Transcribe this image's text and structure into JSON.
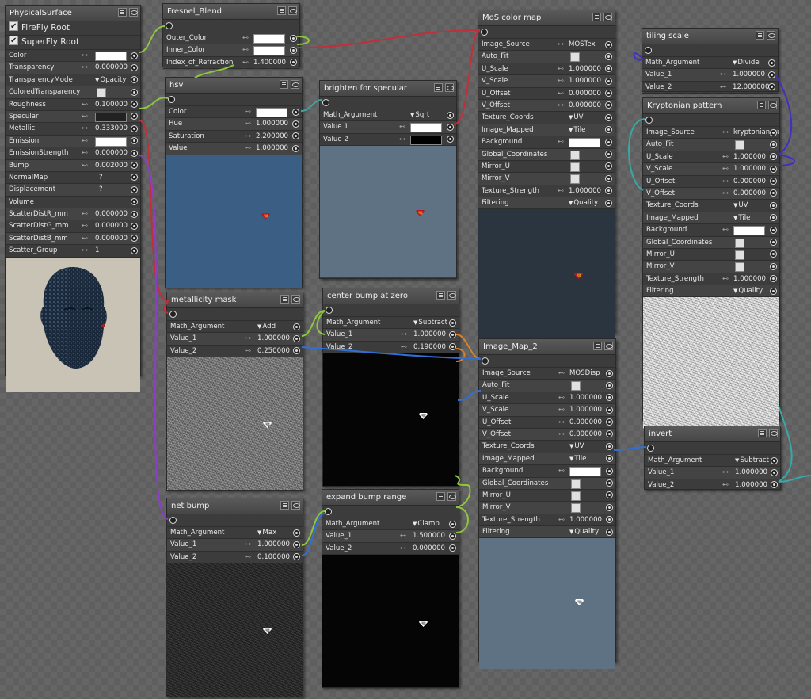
{
  "colors": {
    "wire_red": "#c0303a",
    "wire_green": "#8ec63f",
    "wire_blue": "#2f6fd6",
    "wire_purple": "#8b3ec8",
    "wire_teal": "#3aa7a7",
    "wire_orange": "#d9822b",
    "wire_indigo": "#4030c0",
    "hsv_preview": "#3b5e84",
    "specular_preview": "#5e7284",
    "color_map_preview": "#2b3540",
    "image_map2_preview": "#5e7284"
  },
  "physical": {
    "title": "PhysicalSurface",
    "roots": [
      "FireFly Root",
      "SuperFly Root"
    ],
    "rows": [
      {
        "label": "Color",
        "kind": "swatch"
      },
      {
        "label": "Transparency",
        "value": "0.000000"
      },
      {
        "label": "TransparencyMode",
        "value": "Opacity",
        "kind": "dd"
      },
      {
        "label": "ColoredTransparency",
        "kind": "chk"
      },
      {
        "label": "Roughness",
        "value": "0.100000"
      },
      {
        "label": "Specular",
        "kind": "swatch-dark"
      },
      {
        "label": "Metallic",
        "value": "0.333000"
      },
      {
        "label": "Emission",
        "kind": "swatch"
      },
      {
        "label": "EmissionStrength",
        "value": "0.000000"
      },
      {
        "label": "Bump",
        "value": "0.002000"
      },
      {
        "label": "NormalMap",
        "value": "?"
      },
      {
        "label": "Displacement",
        "value": "?"
      },
      {
        "label": "Volume",
        "value": ""
      },
      {
        "label": "ScatterDistR_mm",
        "value": "0.000000"
      },
      {
        "label": "ScatterDistG_mm",
        "value": "0.000000"
      },
      {
        "label": "ScatterDistB_mm",
        "value": "0.000000"
      },
      {
        "label": "Scatter_Group",
        "value": "1"
      }
    ]
  },
  "fresnel": {
    "title": "Fresnel_Blend",
    "rows": [
      {
        "label": "Outer_Color",
        "kind": "swatch"
      },
      {
        "label": "Inner_Color",
        "kind": "swatch"
      },
      {
        "label": "Index_of_Refraction",
        "value": "1.400000"
      }
    ]
  },
  "hsv": {
    "title": "hsv",
    "rows": [
      {
        "label": "Color",
        "kind": "swatch"
      },
      {
        "label": "Hue",
        "value": "1.000000"
      },
      {
        "label": "Saturation",
        "value": "2.200000"
      },
      {
        "label": "Value",
        "value": "1.000000"
      }
    ]
  },
  "brighten": {
    "title": "brighten for specular",
    "rows": [
      {
        "label": "Math_Argument",
        "value": "Sqrt",
        "kind": "dd"
      },
      {
        "label": "Value 1",
        "kind": "swatch"
      },
      {
        "label": "Value 2",
        "kind": "swatch-black"
      }
    ]
  },
  "colormap": {
    "title": "MoS color map",
    "rows": [
      {
        "label": "Image_Source",
        "value": "MOSTex"
      },
      {
        "label": "Auto_Fit",
        "kind": "chk"
      },
      {
        "label": "U_Scale",
        "value": "1.000000"
      },
      {
        "label": "V_Scale",
        "value": "1.000000"
      },
      {
        "label": "U_Offset",
        "value": "0.000000"
      },
      {
        "label": "V_Offset",
        "value": "0.000000"
      },
      {
        "label": "Texture_Coords",
        "value": "UV",
        "kind": "dd"
      },
      {
        "label": "Image_Mapped",
        "value": "Tile",
        "kind": "dd"
      },
      {
        "label": "Background",
        "kind": "swatch"
      },
      {
        "label": "Global_Coordinates",
        "kind": "chk"
      },
      {
        "label": "Mirror_U",
        "kind": "chk"
      },
      {
        "label": "Mirror_V",
        "kind": "chk"
      },
      {
        "label": "Texture_Strength",
        "value": "1.000000"
      },
      {
        "label": "Filtering",
        "value": "Quality",
        "kind": "dd"
      }
    ]
  },
  "tiling": {
    "title": "tiling scale",
    "rows": [
      {
        "label": "Math_Argument",
        "value": "Divide",
        "kind": "dd"
      },
      {
        "label": "Value_1",
        "value": "1.000000"
      },
      {
        "label": "Value_2",
        "value": "12.000000"
      }
    ]
  },
  "krypt": {
    "title": "Kryptonian pattern",
    "rows": [
      {
        "label": "Image_Source",
        "value": "kryptonian_suit_texture_"
      },
      {
        "label": "Auto_Fit",
        "kind": "chk"
      },
      {
        "label": "U_Scale",
        "value": "1.000000"
      },
      {
        "label": "V_Scale",
        "value": "1.000000"
      },
      {
        "label": "U_Offset",
        "value": "0.000000"
      },
      {
        "label": "V_Offset",
        "value": "0.000000"
      },
      {
        "label": "Texture_Coords",
        "value": "UV",
        "kind": "dd"
      },
      {
        "label": "Image_Mapped",
        "value": "Tile",
        "kind": "dd"
      },
      {
        "label": "Background",
        "kind": "swatch"
      },
      {
        "label": "Global_Coordinates",
        "kind": "chk"
      },
      {
        "label": "Mirror_U",
        "kind": "chk"
      },
      {
        "label": "Mirror_V",
        "kind": "chk"
      },
      {
        "label": "Texture_Strength",
        "value": "1.000000"
      },
      {
        "label": "Filtering",
        "value": "Quality",
        "kind": "dd"
      }
    ]
  },
  "metal": {
    "title": "metallicity mask",
    "rows": [
      {
        "label": "Math_Argument",
        "value": "Add",
        "kind": "dd"
      },
      {
        "label": "Value_1",
        "value": "1.000000"
      },
      {
        "label": "Value_2",
        "value": "0.250000"
      }
    ]
  },
  "center": {
    "title": "center bump at zero",
    "rows": [
      {
        "label": "Math_Argument",
        "value": "Subtract",
        "kind": "dd"
      },
      {
        "label": "Value_1",
        "value": "1.000000"
      },
      {
        "label": "Value_2",
        "value": "0.190000"
      }
    ]
  },
  "imagemap2": {
    "title": "Image_Map_2",
    "rows": [
      {
        "label": "Image_Source",
        "value": "MOSDisp"
      },
      {
        "label": "Auto_Fit",
        "kind": "chk"
      },
      {
        "label": "U_Scale",
        "value": "1.000000"
      },
      {
        "label": "V_Scale",
        "value": "1.000000"
      },
      {
        "label": "U_Offset",
        "value": "0.000000"
      },
      {
        "label": "V_Offset",
        "value": "0.000000"
      },
      {
        "label": "Texture_Coords",
        "value": "UV",
        "kind": "dd"
      },
      {
        "label": "Image_Mapped",
        "value": "Tile",
        "kind": "dd"
      },
      {
        "label": "Background",
        "kind": "swatch"
      },
      {
        "label": "Global_Coordinates",
        "kind": "chk"
      },
      {
        "label": "Mirror_U",
        "kind": "chk"
      },
      {
        "label": "Mirror_V",
        "kind": "chk"
      },
      {
        "label": "Texture_Strength",
        "value": "1.000000"
      },
      {
        "label": "Filtering",
        "value": "Quality",
        "kind": "dd"
      }
    ]
  },
  "invert": {
    "title": "invert",
    "rows": [
      {
        "label": "Math_Argument",
        "value": "Subtract",
        "kind": "dd"
      },
      {
        "label": "Value_1",
        "value": "1.000000"
      },
      {
        "label": "Value_2",
        "value": "1.000000"
      }
    ]
  },
  "netbump": {
    "title": "net bump",
    "rows": [
      {
        "label": "Math_Argument",
        "value": "Max",
        "kind": "dd"
      },
      {
        "label": "Value_1",
        "value": "1.000000"
      },
      {
        "label": "Value_2",
        "value": "0.100000"
      }
    ]
  },
  "expand": {
    "title": "expand bump range",
    "rows": [
      {
        "label": "Math_Argument",
        "value": "Clamp",
        "kind": "dd"
      },
      {
        "label": "Value_1",
        "value": "1.500000"
      },
      {
        "label": "Value_2",
        "value": "0.000000"
      }
    ]
  }
}
